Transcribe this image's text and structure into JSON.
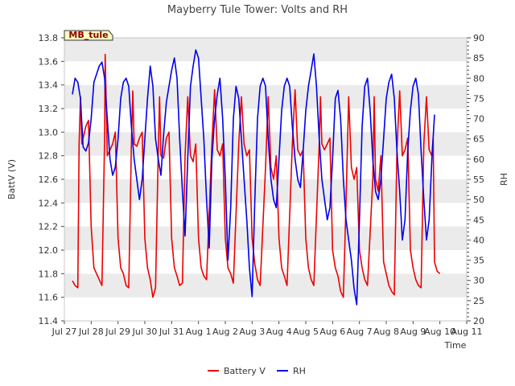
{
  "chart_data": {
    "type": "line",
    "title": "Mayberry Tule Tower: Volts and RH",
    "xlabel": "Time",
    "ylabel_left": "BattV (V)",
    "ylabel_right": "RH",
    "station_label": "MB_tule",
    "colors": {
      "battery": "#ee0000",
      "rh": "#0000ee",
      "band": "#ebebeb",
      "label_bg": "#ffffc0",
      "label_text": "#8b0000"
    },
    "x_ticks": [
      "Jul 27",
      "Jul 28",
      "Jul 29",
      "Jul 30",
      "Jul 31",
      "Aug 1",
      "Aug 2",
      "Aug 3",
      "Aug 4",
      "Aug 5",
      "Aug 6",
      "Aug 7",
      "Aug 8",
      "Aug 9",
      "Aug 10",
      "Aug 11"
    ],
    "xlim": [
      0,
      15
    ],
    "x_unit": "days since Jul 27",
    "y_left_ticks": [
      "11.4",
      "11.6",
      "11.8",
      "12.0",
      "12.2",
      "12.4",
      "12.6",
      "12.8",
      "13.0",
      "13.2",
      "13.4",
      "13.6",
      "13.8"
    ],
    "y_left_lim": [
      11.4,
      13.8
    ],
    "y_right_ticks": [
      "20",
      "25",
      "30",
      "35",
      "40",
      "45",
      "50",
      "55",
      "60",
      "65",
      "70",
      "75",
      "80",
      "85",
      "90"
    ],
    "y_right_lim": [
      20,
      90
    ],
    "legend": [
      "Battery V",
      "RH"
    ],
    "legend_position": "bottom-center",
    "grid": "alternating horizontal bands",
    "series": [
      {
        "name": "Battery V",
        "axis": "left",
        "points": [
          [
            0.3,
            11.74
          ],
          [
            0.4,
            11.7
          ],
          [
            0.5,
            11.68
          ],
          [
            0.55,
            12.9
          ],
          [
            0.6,
            13.3
          ],
          [
            0.65,
            12.9
          ],
          [
            0.7,
            12.95
          ],
          [
            0.8,
            13.05
          ],
          [
            0.9,
            13.1
          ],
          [
            1.0,
            12.2
          ],
          [
            1.1,
            11.85
          ],
          [
            1.2,
            11.8
          ],
          [
            1.3,
            11.75
          ],
          [
            1.4,
            11.7
          ],
          [
            1.5,
            12.95
          ],
          [
            1.52,
            13.66
          ],
          [
            1.6,
            12.8
          ],
          [
            1.7,
            12.85
          ],
          [
            1.8,
            12.9
          ],
          [
            1.9,
            13.0
          ],
          [
            2.0,
            12.1
          ],
          [
            2.1,
            11.85
          ],
          [
            2.2,
            11.8
          ],
          [
            2.3,
            11.7
          ],
          [
            2.4,
            11.68
          ],
          [
            2.5,
            12.9
          ],
          [
            2.55,
            13.35
          ],
          [
            2.6,
            12.9
          ],
          [
            2.7,
            12.88
          ],
          [
            2.8,
            12.95
          ],
          [
            2.9,
            13.0
          ],
          [
            3.0,
            12.1
          ],
          [
            3.1,
            11.85
          ],
          [
            3.2,
            11.75
          ],
          [
            3.3,
            11.6
          ],
          [
            3.4,
            11.68
          ],
          [
            3.5,
            12.85
          ],
          [
            3.55,
            13.3
          ],
          [
            3.6,
            12.8
          ],
          [
            3.7,
            12.78
          ],
          [
            3.8,
            12.95
          ],
          [
            3.9,
            13.0
          ],
          [
            4.0,
            12.1
          ],
          [
            4.1,
            11.85
          ],
          [
            4.2,
            11.78
          ],
          [
            4.3,
            11.7
          ],
          [
            4.4,
            11.72
          ],
          [
            4.5,
            12.8
          ],
          [
            4.6,
            13.3
          ],
          [
            4.7,
            12.8
          ],
          [
            4.8,
            12.75
          ],
          [
            4.9,
            12.9
          ],
          [
            5.0,
            12.1
          ],
          [
            5.1,
            11.85
          ],
          [
            5.2,
            11.78
          ],
          [
            5.3,
            11.75
          ],
          [
            5.5,
            12.9
          ],
          [
            5.6,
            13.36
          ],
          [
            5.7,
            12.85
          ],
          [
            5.8,
            12.8
          ],
          [
            5.9,
            12.9
          ],
          [
            6.0,
            12.1
          ],
          [
            6.1,
            11.85
          ],
          [
            6.2,
            11.8
          ],
          [
            6.3,
            11.72
          ],
          [
            6.5,
            12.9
          ],
          [
            6.6,
            13.3
          ],
          [
            6.7,
            12.9
          ],
          [
            6.8,
            12.8
          ],
          [
            6.9,
            12.85
          ],
          [
            7.0,
            12.1
          ],
          [
            7.1,
            11.88
          ],
          [
            7.2,
            11.75
          ],
          [
            7.3,
            11.7
          ],
          [
            7.5,
            12.7
          ],
          [
            7.6,
            13.3
          ],
          [
            7.7,
            12.7
          ],
          [
            7.8,
            12.6
          ],
          [
            7.9,
            12.8
          ],
          [
            8.0,
            12.1
          ],
          [
            8.1,
            11.85
          ],
          [
            8.2,
            11.78
          ],
          [
            8.3,
            11.7
          ],
          [
            8.5,
            12.9
          ],
          [
            8.6,
            13.36
          ],
          [
            8.7,
            12.85
          ],
          [
            8.8,
            12.8
          ],
          [
            8.9,
            12.85
          ],
          [
            9.0,
            12.1
          ],
          [
            9.1,
            11.85
          ],
          [
            9.2,
            11.75
          ],
          [
            9.3,
            11.7
          ],
          [
            9.5,
            12.9
          ],
          [
            9.55,
            13.3
          ],
          [
            9.6,
            12.9
          ],
          [
            9.7,
            12.85
          ],
          [
            9.8,
            12.9
          ],
          [
            9.9,
            12.95
          ],
          [
            10.0,
            12.0
          ],
          [
            10.1,
            11.85
          ],
          [
            10.2,
            11.78
          ],
          [
            10.3,
            11.65
          ],
          [
            10.4,
            11.6
          ],
          [
            10.5,
            12.4
          ],
          [
            10.6,
            13.3
          ],
          [
            10.7,
            12.7
          ],
          [
            10.8,
            12.6
          ],
          [
            10.9,
            12.7
          ],
          [
            11.0,
            12.0
          ],
          [
            11.1,
            11.85
          ],
          [
            11.2,
            11.75
          ],
          [
            11.3,
            11.7
          ],
          [
            11.5,
            12.6
          ],
          [
            11.55,
            13.3
          ],
          [
            11.6,
            12.6
          ],
          [
            11.7,
            12.5
          ],
          [
            11.8,
            12.8
          ],
          [
            11.9,
            11.9
          ],
          [
            12.0,
            11.8
          ],
          [
            12.1,
            11.7
          ],
          [
            12.2,
            11.65
          ],
          [
            12.3,
            11.62
          ],
          [
            12.4,
            12.85
          ],
          [
            12.5,
            13.35
          ],
          [
            12.6,
            12.8
          ],
          [
            12.7,
            12.85
          ],
          [
            12.8,
            12.95
          ],
          [
            12.9,
            12.0
          ],
          [
            13.0,
            11.85
          ],
          [
            13.1,
            11.75
          ],
          [
            13.2,
            11.7
          ],
          [
            13.3,
            11.68
          ],
          [
            13.4,
            12.9
          ],
          [
            13.5,
            13.3
          ],
          [
            13.6,
            12.85
          ],
          [
            13.7,
            12.8
          ],
          [
            13.75,
            12.95
          ],
          [
            13.8,
            11.9
          ],
          [
            13.9,
            11.82
          ],
          [
            14.0,
            11.8
          ]
        ]
      },
      {
        "name": "RH",
        "axis": "right",
        "points": [
          [
            0.3,
            76
          ],
          [
            0.4,
            80
          ],
          [
            0.5,
            79
          ],
          [
            0.6,
            75
          ],
          [
            0.7,
            63
          ],
          [
            0.8,
            62
          ],
          [
            0.9,
            64
          ],
          [
            1.0,
            70
          ],
          [
            1.1,
            79
          ],
          [
            1.2,
            81
          ],
          [
            1.3,
            83
          ],
          [
            1.4,
            84
          ],
          [
            1.5,
            80
          ],
          [
            1.6,
            70
          ],
          [
            1.7,
            60
          ],
          [
            1.8,
            56
          ],
          [
            1.9,
            58
          ],
          [
            2.0,
            65
          ],
          [
            2.1,
            75
          ],
          [
            2.2,
            79
          ],
          [
            2.3,
            80
          ],
          [
            2.4,
            78
          ],
          [
            2.5,
            68
          ],
          [
            2.6,
            60
          ],
          [
            2.7,
            55
          ],
          [
            2.8,
            50
          ],
          [
            2.9,
            55
          ],
          [
            3.0,
            65
          ],
          [
            3.1,
            75
          ],
          [
            3.2,
            83
          ],
          [
            3.3,
            78
          ],
          [
            3.4,
            65
          ],
          [
            3.5,
            60
          ],
          [
            3.6,
            56
          ],
          [
            3.7,
            66
          ],
          [
            3.8,
            74
          ],
          [
            3.9,
            78
          ],
          [
            4.0,
            82
          ],
          [
            4.1,
            85
          ],
          [
            4.2,
            80
          ],
          [
            4.3,
            65
          ],
          [
            4.4,
            52
          ],
          [
            4.5,
            41
          ],
          [
            4.6,
            60
          ],
          [
            4.7,
            78
          ],
          [
            4.8,
            83
          ],
          [
            4.9,
            87
          ],
          [
            5.0,
            85
          ],
          [
            5.1,
            75
          ],
          [
            5.2,
            65
          ],
          [
            5.3,
            50
          ],
          [
            5.4,
            38
          ],
          [
            5.5,
            60
          ],
          [
            5.6,
            70
          ],
          [
            5.7,
            76
          ],
          [
            5.8,
            80
          ],
          [
            5.9,
            70
          ],
          [
            6.0,
            55
          ],
          [
            6.1,
            35
          ],
          [
            6.2,
            48
          ],
          [
            6.3,
            70
          ],
          [
            6.4,
            78
          ],
          [
            6.5,
            75
          ],
          [
            6.6,
            65
          ],
          [
            6.7,
            55
          ],
          [
            6.8,
            45
          ],
          [
            6.9,
            33
          ],
          [
            7.0,
            26
          ],
          [
            7.1,
            50
          ],
          [
            7.2,
            70
          ],
          [
            7.3,
            78
          ],
          [
            7.4,
            80
          ],
          [
            7.5,
            78
          ],
          [
            7.6,
            65
          ],
          [
            7.7,
            55
          ],
          [
            7.8,
            50
          ],
          [
            7.9,
            48
          ],
          [
            8.0,
            60
          ],
          [
            8.1,
            72
          ],
          [
            8.2,
            78
          ],
          [
            8.3,
            80
          ],
          [
            8.4,
            78
          ],
          [
            8.5,
            68
          ],
          [
            8.6,
            60
          ],
          [
            8.7,
            55
          ],
          [
            8.8,
            53
          ],
          [
            8.9,
            62
          ],
          [
            9.0,
            72
          ],
          [
            9.1,
            78
          ],
          [
            9.2,
            82
          ],
          [
            9.3,
            86
          ],
          [
            9.4,
            78
          ],
          [
            9.5,
            65
          ],
          [
            9.6,
            55
          ],
          [
            9.7,
            50
          ],
          [
            9.8,
            45
          ],
          [
            9.9,
            48
          ],
          [
            10.0,
            60
          ],
          [
            10.1,
            75
          ],
          [
            10.2,
            77
          ],
          [
            10.3,
            70
          ],
          [
            10.4,
            55
          ],
          [
            10.5,
            45
          ],
          [
            10.6,
            40
          ],
          [
            10.7,
            35
          ],
          [
            10.8,
            28
          ],
          [
            10.9,
            24
          ],
          [
            11.0,
            45
          ],
          [
            11.1,
            68
          ],
          [
            11.2,
            78
          ],
          [
            11.3,
            80
          ],
          [
            11.4,
            72
          ],
          [
            11.5,
            60
          ],
          [
            11.6,
            52
          ],
          [
            11.7,
            50
          ],
          [
            11.8,
            55
          ],
          [
            11.9,
            65
          ],
          [
            12.0,
            75
          ],
          [
            12.1,
            79
          ],
          [
            12.2,
            81
          ],
          [
            12.3,
            75
          ],
          [
            12.4,
            62
          ],
          [
            12.5,
            52
          ],
          [
            12.6,
            40
          ],
          [
            12.7,
            45
          ],
          [
            12.8,
            62
          ],
          [
            12.9,
            72
          ],
          [
            13.0,
            78
          ],
          [
            13.1,
            80
          ],
          [
            13.2,
            76
          ],
          [
            13.3,
            62
          ],
          [
            13.4,
            50
          ],
          [
            13.5,
            40
          ],
          [
            13.6,
            45
          ],
          [
            13.7,
            60
          ],
          [
            13.8,
            71
          ]
        ]
      }
    ]
  }
}
